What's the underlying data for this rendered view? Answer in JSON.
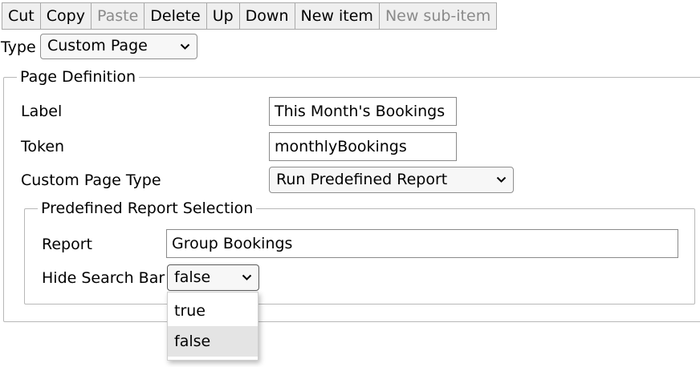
{
  "toolbar": {
    "cut": "Cut",
    "copy": "Copy",
    "paste": "Paste",
    "delete": "Delete",
    "up": "Up",
    "down": "Down",
    "new_item": "New item",
    "new_sub_item": "New sub-item"
  },
  "type": {
    "label": "Type",
    "value": "Custom Page"
  },
  "page_definition": {
    "legend": "Page Definition",
    "label_label": "Label",
    "label_value": "This Month's Bookings",
    "token_label": "Token",
    "token_value": "monthlyBookings",
    "custom_page_type_label": "Custom Page Type",
    "custom_page_type_value": "Run Predefined Report"
  },
  "report_selection": {
    "legend": "Predefined Report Selection",
    "report_label": "Report",
    "report_value": "Group Bookings",
    "hide_search_bar_label": "Hide Search Bar",
    "hide_search_bar_value": "false",
    "hide_search_bar_options": [
      "true",
      "false"
    ]
  },
  "icons": {
    "select_arrow": "chevron-down-icon"
  },
  "colors": {
    "button_bg": "#efefef",
    "disabled_text": "#8a8a8a",
    "fieldset_border": "#b8b8b8",
    "option_highlight": "#e4e4e4"
  }
}
